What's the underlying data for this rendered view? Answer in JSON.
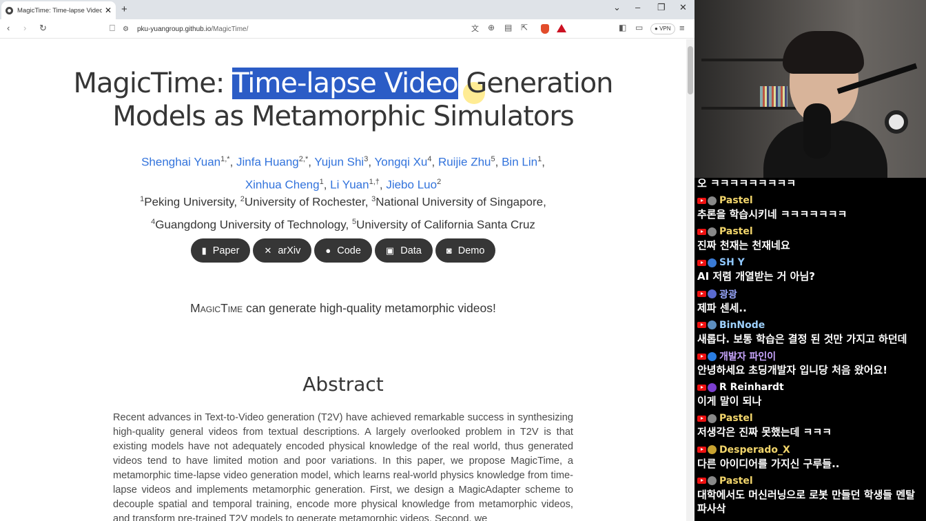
{
  "browser": {
    "tab_title": "MagicTime: Time-lapse Video",
    "new_tab": "+",
    "url_host": "pku-yuangroup.github.io",
    "url_path": "/MagicTime/",
    "vpn_label": "VPN",
    "icons": [
      "back-icon",
      "forward-icon",
      "reload-icon",
      "bookmark-icon",
      "site-info-icon",
      "translate-icon",
      "zoom-icon",
      "reader-icon",
      "share-icon",
      "brave-shield-icon",
      "brave-rewards-icon",
      "sidebar-icon",
      "wallet-icon",
      "menu-icon"
    ]
  },
  "page": {
    "title_part1": "MagicTime: ",
    "title_highlight": "Time-lapse Video",
    "title_part2": " Generation",
    "title_line2": "Models as Metamorphic Simulators",
    "authors_line1": [
      {
        "name": "Shenghai Yuan",
        "sup": "1,*"
      },
      {
        "name": "Jinfa Huang",
        "sup": "2,*"
      },
      {
        "name": "Yujun Shi",
        "sup": "3"
      },
      {
        "name": "Yongqi Xu",
        "sup": "4"
      },
      {
        "name": "Ruijie Zhu",
        "sup": "5"
      },
      {
        "name": "Bin Lin",
        "sup": "1"
      }
    ],
    "authors_line2": [
      {
        "name": "Xinhua Cheng",
        "sup": "1"
      },
      {
        "name": "Li Yuan",
        "sup": "1,†"
      },
      {
        "name": "Jiebo Luo",
        "sup": "2"
      }
    ],
    "affiliations_line1": [
      {
        "sup": "1",
        "name": "Peking University"
      },
      {
        "sup": "2",
        "name": "University of Rochester"
      },
      {
        "sup": "3",
        "name": "National University of Singapore"
      }
    ],
    "affiliations_line2": [
      {
        "sup": "4",
        "name": "Guangdong University of Technology"
      },
      {
        "sup": "5",
        "name": "University of California Santa Cruz"
      }
    ],
    "buttons": [
      {
        "label": "Paper",
        "icon": "pdf-icon",
        "glyph": "▮"
      },
      {
        "label": "arXiv",
        "icon": "x-icon",
        "glyph": "✕"
      },
      {
        "label": "Code",
        "icon": "github-icon",
        "glyph": "●"
      },
      {
        "label": "Data",
        "icon": "images-icon",
        "glyph": "▣"
      },
      {
        "label": "Demo",
        "icon": "robot-icon",
        "glyph": "◙"
      }
    ],
    "tagline_name": "MagicTime",
    "tagline_rest": " can generate high-quality metamorphic videos!",
    "abstract_heading": "Abstract",
    "abstract_text": "Recent advances in Text-to-Video generation (T2V) have achieved remarkable success in synthesizing high-quality general videos from textual descriptions. A largely overlooked problem in T2V is that existing models have not adequately encoded physical knowledge of the real world, thus generated videos tend to have limited motion and poor variations. In this paper, we propose MagicTime, a metamorphic time-lapse video generation model, which learns real-world physics knowledge from time-lapse videos and implements metamorphic generation. First, we design a MagicAdapter scheme to decouple spatial and temporal training, encode more physical knowledge from metamorphic videos, and transform pre-trained T2V models to generate metamorphic videos. Second, we"
  },
  "chat": {
    "top_partial": "오 ㅋㅋㅋㅋㅋㅋㅋㅋㅋ",
    "messages": [
      {
        "name": "Pastel",
        "color": "#f2d56b",
        "avatar": "#888",
        "text": "추론을 학습시키네 ㅋㅋㅋㅋㅋㅋㅋ"
      },
      {
        "name": "Pastel",
        "color": "#f2d56b",
        "avatar": "#888",
        "text": "진짜 천재는 천재네요"
      },
      {
        "name": "SH Y",
        "color": "#8fc7ff",
        "avatar": "#3a7bd5",
        "text": "AI 저렴 개열받는 거 아님?"
      },
      {
        "name": "광광",
        "color": "#9aa8ff",
        "avatar": "#5a6ad0",
        "text": "제파 센세.."
      },
      {
        "name": "BinNode",
        "color": "#9fd2ff",
        "avatar": "#5d8fc0",
        "text": "새롭다. 보통 학습은 결정 된 것만 가지고 하던데"
      },
      {
        "name": "개발자 파인이",
        "color": "#c9a6ff",
        "avatar": "#2a7de1",
        "text": "안녕하세요 초딩개발자 입니당 처음 왔어요!"
      },
      {
        "name": "R Reinhardt",
        "color": "#ffffff",
        "avatar": "#7b3fd0",
        "text": "이게 말이 되나"
      },
      {
        "name": "Pastel",
        "color": "#f2d56b",
        "avatar": "#888",
        "text": "저생각은 진짜 못했는데 ㅋㅋㅋ"
      },
      {
        "name": "Desperado_X",
        "color": "#f2d56b",
        "avatar": "#c8a230",
        "text": "다른 아이디어를 가지신 구루들.."
      },
      {
        "name": "Pastel",
        "color": "#f2d56b",
        "avatar": "#888",
        "text": "대학에서도 머신러닝으로 로봇 만들던 학생들 멘탈 파사삭"
      }
    ]
  }
}
